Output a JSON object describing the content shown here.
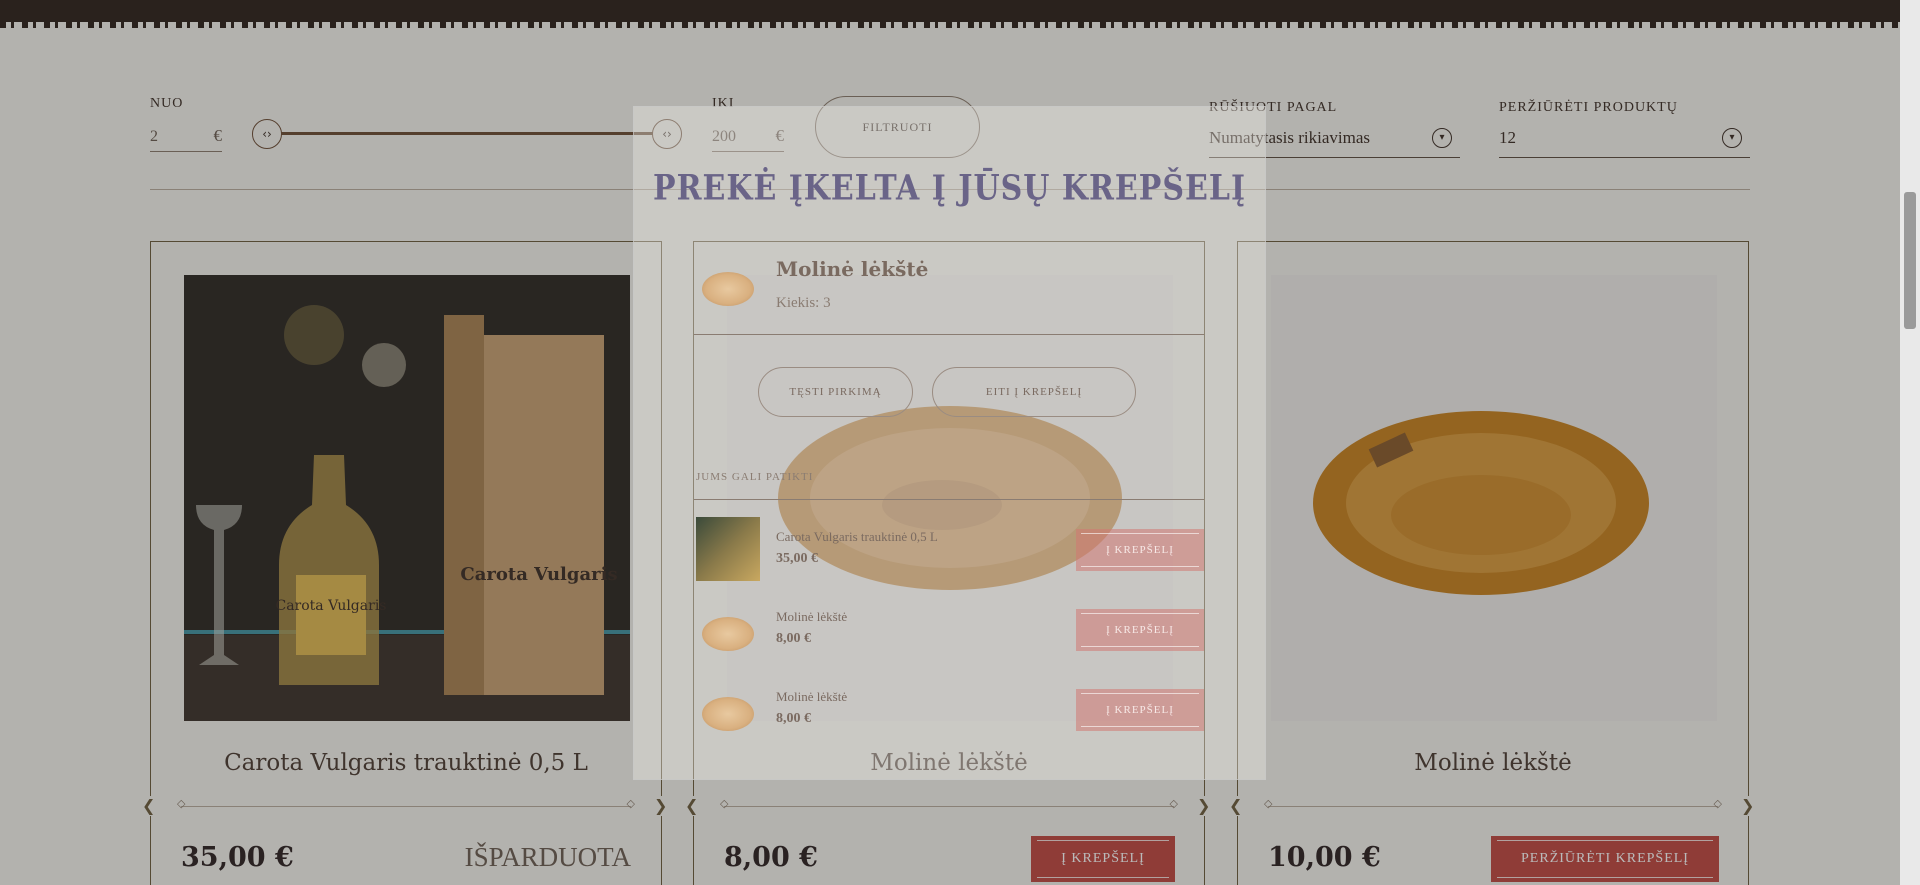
{
  "filters": {
    "from_label": "NUO",
    "from_value": "2",
    "to_label": "IKI",
    "to_value": "200",
    "currency": "€",
    "filter_button": "FILTRUOTI",
    "sort_label": "RŪŠIUOTI PAGAL",
    "sort_value": "Numatytasis rikiavimas",
    "per_page_label": "PERŽIŪRĖTI PRODUKTŲ",
    "per_page_value": "12"
  },
  "products": [
    {
      "title": "Carota Vulgaris trauktinė 0,5 L",
      "price": "35,00 €",
      "status": "IŠPARDUOTA",
      "bottle_label": "Carota Vulgaris",
      "box_label": "Carota Vulgaris"
    },
    {
      "title": "Molinė lėkštė",
      "price": "8,00 €",
      "button": "Į KREPŠELĮ"
    },
    {
      "title": "Molinė lėkštė",
      "price": "10,00 €",
      "button": "PERŽIŪRĖTI KREPŠELĮ"
    }
  ],
  "modal": {
    "title": "PREKĖ ĮKELTA Į JŪSŲ KREPŠELĮ",
    "item_name": "Molinė lėkštė",
    "item_qty": "Kiekis: 3",
    "continue_button": "TĘSTI PIRKIMĄ",
    "go_cart_button": "EITI Į KREPŠELĮ",
    "suggest_heading": "JUMS GALI PATIKTI",
    "suggestions": [
      {
        "name": "Carota Vulgaris trauktinė 0,5 L",
        "price": "35,00 €",
        "button": "Į KREPŠELĮ"
      },
      {
        "name": "Molinė lėkštė",
        "price": "8,00 €",
        "button": "Į KREPŠELĮ"
      },
      {
        "name": "Molinė lėkštė",
        "price": "8,00 €",
        "button": "Į KREPŠELĮ"
      }
    ]
  },
  "colors": {
    "accent": "#c0463e",
    "background": "#f5f3ee",
    "text": "#3a2b22"
  }
}
